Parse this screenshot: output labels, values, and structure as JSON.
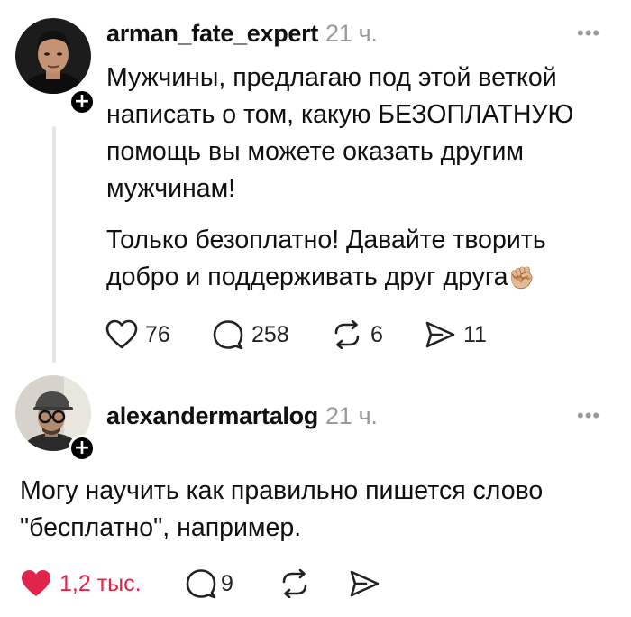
{
  "post1": {
    "username": "arman_fate_expert",
    "time": "21 ч.",
    "paragraph1": "Мужчины, предлагаю под этой веткой написать о том, какую БЕЗОПЛАТНУЮ помощь вы можете оказать другим мужчинам!",
    "paragraph2": "Только безоплатно! Давайте творить добро и поддерживать друг друга",
    "emoji": "✊🏼",
    "actions": {
      "likes": "76",
      "comments": "258",
      "reposts": "6",
      "shares": "11"
    }
  },
  "post2": {
    "username": "alexandermartalog",
    "time": "21 ч.",
    "text": "Могу научить как правильно пишется слово \"бесплатно\", например.",
    "actions": {
      "likes": "1,2 тыс.",
      "comments": "9"
    }
  },
  "icons": {
    "like": "heart-icon",
    "like_filled": "heart-filled-icon",
    "comment": "comment-bubble-icon",
    "repost": "repost-icon",
    "share": "send-icon",
    "more": "more-dots-icon",
    "follow": "plus-icon"
  },
  "colors": {
    "like_active": "#e0244a",
    "muted": "#9a9a9a",
    "thread_line": "#e4e4e4"
  }
}
